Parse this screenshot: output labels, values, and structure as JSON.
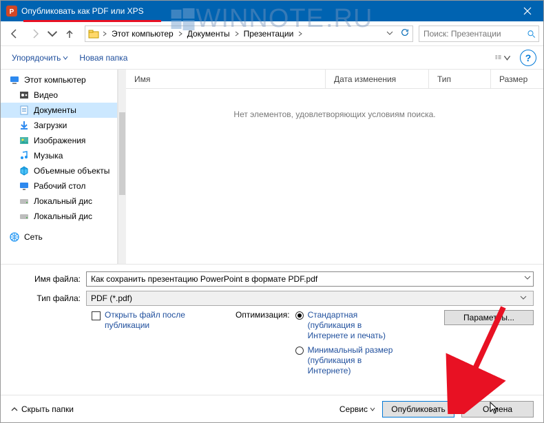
{
  "window": {
    "title": "Опубликовать как PDF или XPS"
  },
  "nav": {
    "crumbs": [
      "Этот компьютер",
      "Документы",
      "Презентации"
    ],
    "search_placeholder": "Поиск: Презентации"
  },
  "toolbar": {
    "organize": "Упорядочить",
    "newfolder": "Новая папка"
  },
  "tree": {
    "items": [
      {
        "label": "Этот компьютер",
        "icon": "pc",
        "indent": false
      },
      {
        "label": "Видео",
        "icon": "video",
        "indent": true
      },
      {
        "label": "Документы",
        "icon": "doc",
        "indent": true,
        "selected": true
      },
      {
        "label": "Загрузки",
        "icon": "down",
        "indent": true
      },
      {
        "label": "Изображения",
        "icon": "img",
        "indent": true
      },
      {
        "label": "Музыка",
        "icon": "music",
        "indent": true
      },
      {
        "label": "Объемные объекты",
        "icon": "cube",
        "indent": true
      },
      {
        "label": "Рабочий стол",
        "icon": "desk",
        "indent": true
      },
      {
        "label": "Локальный диск",
        "icon": "disk",
        "indent": true,
        "short": "Локальный дис"
      },
      {
        "label": "Локальный диск",
        "icon": "disk",
        "indent": true,
        "short": "Локальный дис"
      }
    ],
    "network": "Сеть"
  },
  "columns": {
    "name": "Имя",
    "date": "Дата изменения",
    "type": "Тип",
    "size": "Размер"
  },
  "list": {
    "empty": "Нет элементов, удовлетворяющих условиям поиска."
  },
  "form": {
    "filename_label": "Имя файла:",
    "filename_value": "Как сохранить презентацию PowerPoint в формате PDF.pdf",
    "filetype_label": "Тип файла:",
    "filetype_value": "PDF (*.pdf)",
    "open_after": "Открыть файл после публикации",
    "optimization": "Оптимизация:",
    "opt_std": "Стандартная (публикация в Интернете и печать)",
    "opt_min": "Минимальный размер (публикация в Интернете)",
    "params": "Параметры..."
  },
  "footer": {
    "hide": "Скрыть папки",
    "service": "Сервис",
    "publish": "Опубликовать",
    "cancel": "Отмена"
  },
  "watermark": {
    "text1": "WINNOTE",
    "text2": ".RU"
  }
}
